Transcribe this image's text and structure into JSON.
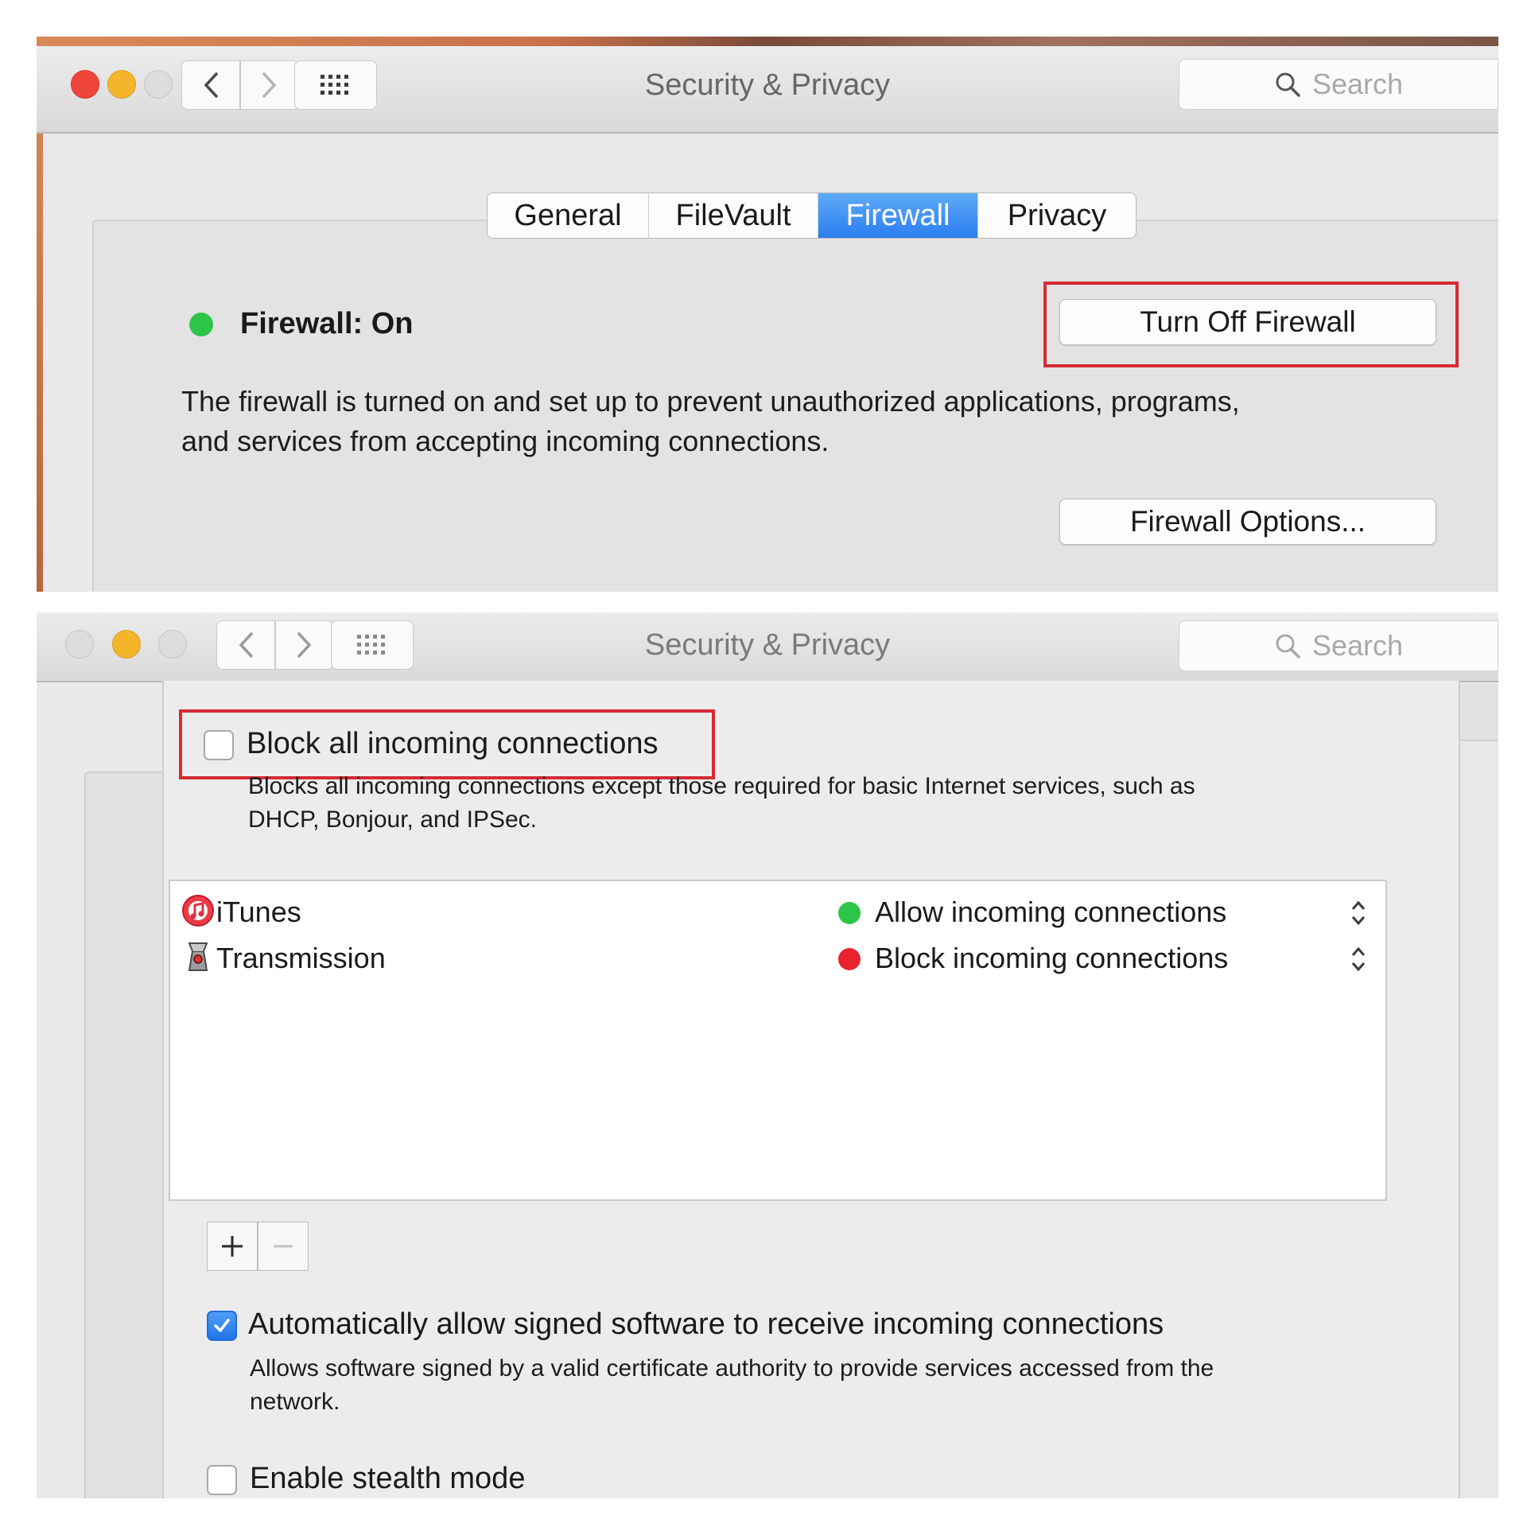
{
  "window1": {
    "title": "Security & Privacy",
    "search_placeholder": "Search",
    "tabs": [
      {
        "label": "General"
      },
      {
        "label": "FileVault"
      },
      {
        "label": "Firewall"
      },
      {
        "label": "Privacy"
      }
    ],
    "active_tab": "Firewall",
    "status_label": "Firewall: On",
    "description_line1": "The firewall is turned on and set up to prevent unauthorized applications, programs,",
    "description_line2": "and services from accepting incoming connections.",
    "turn_off_button": "Turn Off Firewall",
    "options_button": "Firewall Options...",
    "colors": {
      "status_on": "#2dc548",
      "highlight": "#d42b34",
      "tab_active": "#2b7ef0"
    }
  },
  "window2": {
    "title": "Security & Privacy",
    "search_placeholder": "Search",
    "block_all": {
      "label": "Block all incoming connections",
      "checked": false,
      "description_line1": "Blocks all incoming connections except those required for basic Internet services,  such as",
      "description_line2": "DHCP, Bonjour, and IPSec."
    },
    "apps": [
      {
        "name": "iTunes",
        "icon": "itunes-icon",
        "status": "Allow incoming connections",
        "status_color": "#2dc548"
      },
      {
        "name": "Transmission",
        "icon": "transmission-icon",
        "status": "Block incoming connections",
        "status_color": "#e8222e"
      }
    ],
    "add_button": "+",
    "remove_button": "−",
    "auto_allow": {
      "label": "Automatically allow signed software to receive incoming connections",
      "checked": true,
      "description_line1": "Allows software signed by a valid certificate authority to provide services accessed from the",
      "description_line2": "network."
    },
    "stealth": {
      "label": "Enable stealth mode",
      "checked": false
    }
  }
}
